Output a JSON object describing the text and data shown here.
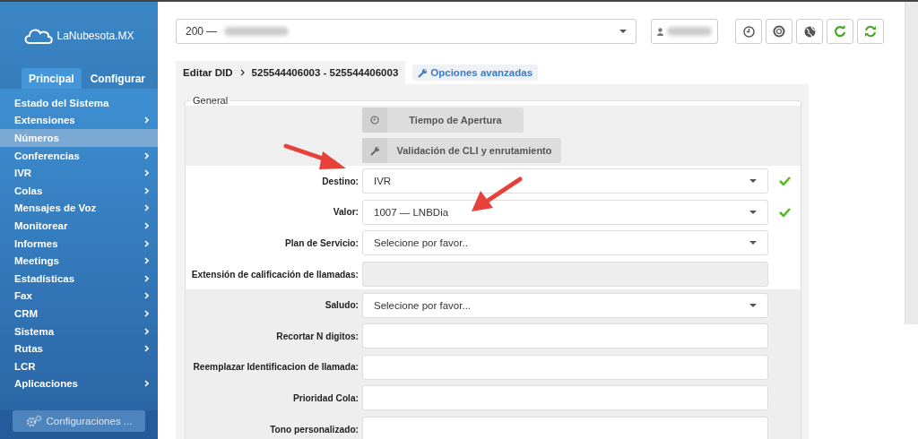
{
  "sidebar": {
    "logo": "LaNubesota.MX",
    "tabs": [
      {
        "label": "Principal",
        "selected": true
      },
      {
        "label": "Configurar",
        "selected": false
      }
    ],
    "items": [
      {
        "label": "Estado del Sistema",
        "selected": false,
        "has_submenu": false
      },
      {
        "label": "Extensiones",
        "selected": false,
        "has_submenu": true
      },
      {
        "label": "Números",
        "selected": true,
        "has_submenu": false
      },
      {
        "label": "Conferencias",
        "selected": false,
        "has_submenu": true
      },
      {
        "label": "IVR",
        "selected": false,
        "has_submenu": true
      },
      {
        "label": "Colas",
        "selected": false,
        "has_submenu": true
      },
      {
        "label": "Mensajes de Voz",
        "selected": false,
        "has_submenu": true
      },
      {
        "label": "Monitorear",
        "selected": false,
        "has_submenu": true
      },
      {
        "label": "Informes",
        "selected": false,
        "has_submenu": true
      },
      {
        "label": "Meetings",
        "selected": false,
        "has_submenu": true
      },
      {
        "label": "Estadísticas",
        "selected": false,
        "has_submenu": true
      },
      {
        "label": "Fax",
        "selected": false,
        "has_submenu": true
      },
      {
        "label": "CRM",
        "selected": false,
        "has_submenu": true
      },
      {
        "label": "Sistema",
        "selected": false,
        "has_submenu": true
      },
      {
        "label": "Rutas",
        "selected": false,
        "has_submenu": true
      },
      {
        "label": "LCR",
        "selected": false,
        "has_submenu": false
      },
      {
        "label": "Aplicaciones",
        "selected": false,
        "has_submenu": true
      }
    ],
    "settings_button": "Configuraciones ..."
  },
  "topbar": {
    "account_select": "200 —",
    "toolbar": [
      {
        "kind": "clock",
        "color": "#555555"
      },
      {
        "kind": "lifebuoy",
        "color": "#555555"
      },
      {
        "kind": "globe",
        "color": "#555555"
      },
      {
        "kind": "reload",
        "color": "#44aa22"
      },
      {
        "kind": "sync",
        "color": "#44aa22"
      }
    ]
  },
  "breadcrumb": {
    "root": "Editar DID",
    "current": "525544406003 - 525544406003",
    "advanced_link": "Opciones avanzadas"
  },
  "form": {
    "legend": "General",
    "buttons": [
      {
        "kind": "clock",
        "label": "Tiempo de Apertura"
      },
      {
        "kind": "wrench",
        "label": "Validación de CLI y enrutamiento"
      }
    ],
    "groups": [
      {
        "shaded": false,
        "fields": [
          {
            "label": "Destino:",
            "kind": "select",
            "value": "IVR",
            "valid": true
          },
          {
            "label": "Valor:",
            "kind": "select",
            "value": "1007  —  LNBDia",
            "valid": true
          },
          {
            "label": "Plan de Servicio:",
            "kind": "select",
            "value": "Selecione por favor..",
            "valid": false
          },
          {
            "label": "Extensión de calificación de llamadas:",
            "kind": "disabled",
            "valid": false
          }
        ]
      },
      {
        "shaded": true,
        "fields": [
          {
            "label": "Saludo:",
            "kind": "select",
            "value": "Selecione por favor...",
            "valid": false
          },
          {
            "label": "Recortar N digitos:",
            "kind": "text",
            "valid": false
          },
          {
            "label": "Reemplazar Identificacion de llamada:",
            "kind": "text",
            "valid": false
          },
          {
            "label": "Prioridad Cola:",
            "kind": "text",
            "valid": false
          },
          {
            "label": "Tono personalizado:",
            "kind": "text",
            "valid": false
          }
        ]
      }
    ]
  }
}
